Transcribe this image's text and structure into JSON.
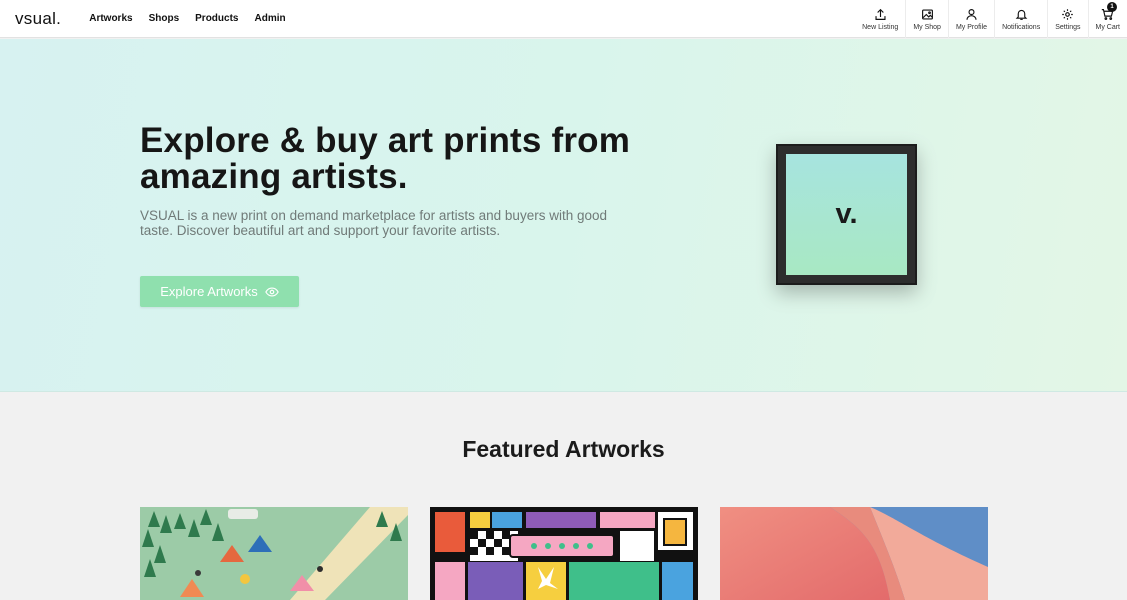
{
  "nav": {
    "logo": "vsual.",
    "links": [
      "Artworks",
      "Shops",
      "Products",
      "Admin"
    ],
    "actions": [
      {
        "label": "New Listing",
        "icon": "upload-icon"
      },
      {
        "label": "My Shop",
        "icon": "image-icon"
      },
      {
        "label": "My Profile",
        "icon": "user-icon"
      },
      {
        "label": "Notifications",
        "icon": "bell-icon"
      },
      {
        "label": "Settings",
        "icon": "gear-icon"
      },
      {
        "label": "My Cart",
        "icon": "cart-icon",
        "badge": "1"
      }
    ]
  },
  "hero": {
    "title": "Explore & buy art prints from amazing artists.",
    "subtitle": "VSUAL is a new print on demand marketplace for artists and buyers with good taste. Discover beautiful art and support your favorite artists.",
    "button_label": "Explore Artworks",
    "button_icon": "eye-icon",
    "frame_mark": "v.",
    "colors": {
      "button": "#8fe0ae",
      "background_start": "#d7f2f1",
      "background_end": "#e3f6e6"
    }
  },
  "featured": {
    "title": "Featured Artworks",
    "artworks": [
      {
        "style": "forest-camp-illustration"
      },
      {
        "style": "colorful-geometric-pattern"
      },
      {
        "style": "abstract-pink-on-blue"
      }
    ]
  }
}
